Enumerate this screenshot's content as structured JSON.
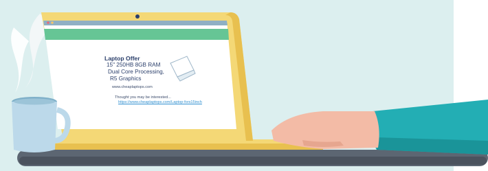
{
  "ad": {
    "title": "Laptop Offer",
    "lines": [
      "15\" 250HB 8GB RAM",
      "Dual Core Processing,",
      "R5 Graphics"
    ],
    "site": "www.cheaplaptops.com"
  },
  "message": {
    "text": "Thought you may be interested...",
    "link": "https://www.cheaplaptops.com/Laptop-fors15inch"
  },
  "icons": [
    "laptop-icon",
    "window-dot-icon"
  ],
  "colors": {
    "background": "#dcefef",
    "laptop_frame": "#f4d876",
    "laptop_frame_dark": "#e8c04f",
    "screen_header": "#66c595",
    "browser_bar": "#8fb0c4",
    "sleeve": "#23aeb4",
    "hand": "#f3bba6",
    "desk": "#5c6672",
    "mug": "#bcd9ea"
  }
}
